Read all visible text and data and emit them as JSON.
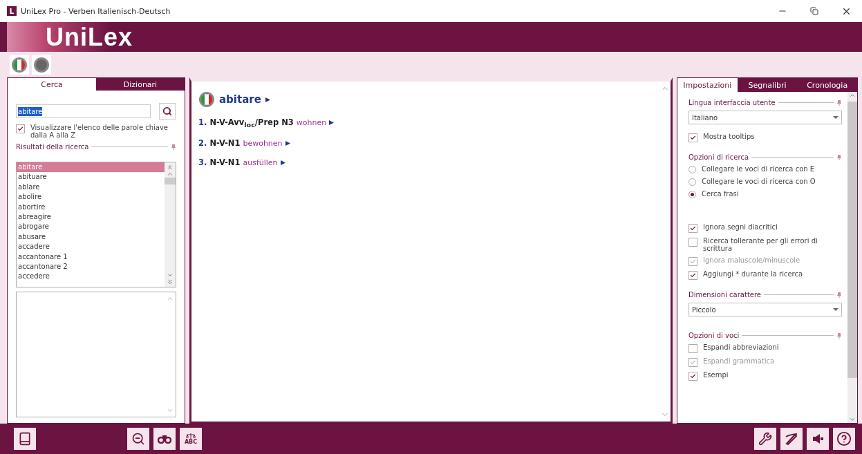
{
  "window": {
    "title": "UniLex Pro - Verben Italienisch-Deutsch",
    "app_icon": "L"
  },
  "logo": {
    "text": "UniLex"
  },
  "left_panel": {
    "tabs": [
      {
        "label": "Cerca",
        "selected": true
      },
      {
        "label": "Dizionari",
        "selected": false
      }
    ],
    "search": {
      "value": "abitare"
    },
    "az_option": {
      "label": "Visualizzare l'elenco delle parole chiave dalla A alla Z",
      "checked": true
    },
    "results_title": "Risultati della ricerca",
    "results": [
      {
        "label": "abitare",
        "selected": true
      },
      {
        "label": "abituare",
        "selected": false
      },
      {
        "label": "ablare",
        "selected": false
      },
      {
        "label": "abolire",
        "selected": false
      },
      {
        "label": "abortire",
        "selected": false
      },
      {
        "label": "abreagire",
        "selected": false
      },
      {
        "label": "abrogare",
        "selected": false
      },
      {
        "label": "abusare",
        "selected": false
      },
      {
        "label": "accadere",
        "selected": false
      },
      {
        "label": "accantonare 1",
        "selected": false
      },
      {
        "label": "accantonare 2",
        "selected": false
      },
      {
        "label": "accedere",
        "selected": false
      }
    ]
  },
  "entry": {
    "headword": "abitare",
    "senses": [
      {
        "number": "1.",
        "pattern": "N-V-Avv$_{loc}$/Prep N3",
        "translation": "wohnen"
      },
      {
        "number": "2.",
        "pattern": "N-V-N1",
        "translation": "bewohnen"
      },
      {
        "number": "3.",
        "pattern": "N-V-N1",
        "translation": "ausfüllen"
      }
    ]
  },
  "right_panel": {
    "tabs": [
      {
        "label": "Impostazioni",
        "selected": true
      },
      {
        "label": "Segnalibri",
        "selected": false
      },
      {
        "label": "Cronologia",
        "selected": false
      }
    ],
    "items": [
      {
        "kind": "section",
        "label": "Lingua interfaccia utente"
      },
      {
        "kind": "select",
        "value": "Italiano"
      },
      {
        "kind": "checkbox",
        "label": "Mostra tooltips",
        "checked": true,
        "disabled": false
      },
      {
        "kind": "section",
        "label": "Opzioni di ricerca"
      },
      {
        "kind": "radio",
        "label": "Collegare le voci di ricerca con E",
        "selected": false
      },
      {
        "kind": "radio",
        "label": "Collegare le voci di ricerca con O",
        "selected": false
      },
      {
        "kind": "radio",
        "label": "Cerca frasi",
        "selected": true
      },
      {
        "kind": "checkbox",
        "label": "Ignora segni diacritici",
        "checked": true,
        "disabled": false
      },
      {
        "kind": "checkbox",
        "label": "Ricerca tollerante per gli errori di scrittura",
        "checked": false,
        "disabled": false
      },
      {
        "kind": "checkbox",
        "label": "Ignora maiuscole/minuscole",
        "checked": true,
        "disabled": true
      },
      {
        "kind": "checkbox",
        "label": "Aggiungi * durante la ricerca",
        "checked": true,
        "disabled": false
      },
      {
        "kind": "section",
        "label": "Dimensioni carattere"
      },
      {
        "kind": "select",
        "value": "Piccolo"
      },
      {
        "kind": "section",
        "label": "Opzioni di voci"
      },
      {
        "kind": "checkbox",
        "label": "Espandi abbreviazioni",
        "checked": false,
        "disabled": false
      },
      {
        "kind": "checkbox",
        "label": "Espandi grammatica",
        "checked": true,
        "disabled": true
      },
      {
        "kind": "checkbox",
        "label": "Esempi",
        "checked": true,
        "disabled": false
      }
    ]
  },
  "bottom_bar": {
    "abc_label": "ABC"
  }
}
